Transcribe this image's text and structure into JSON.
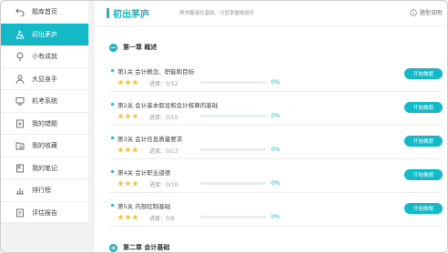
{
  "sidebar": {
    "items": [
      {
        "label": "题库首页",
        "icon": "back-arrow-icon",
        "active": false
      },
      {
        "label": "初出茅庐",
        "icon": "mountain-flag-icon",
        "active": true
      },
      {
        "label": "小有成就",
        "icon": "pin-icon",
        "active": false
      },
      {
        "label": "大显身手",
        "icon": "person-icon",
        "active": false
      },
      {
        "label": "机考系统",
        "icon": "monitor-icon",
        "active": false
      },
      {
        "label": "我的错题",
        "icon": "wrong-book-icon",
        "active": false
      },
      {
        "label": "我的收藏",
        "icon": "folder-star-icon",
        "active": false
      },
      {
        "label": "我的笔记",
        "icon": "notebook-icon",
        "active": false
      },
      {
        "label": "排行榜",
        "icon": "bar-chart-icon",
        "active": false
      },
      {
        "label": "评估报告",
        "icon": "report-icon",
        "active": false
      }
    ]
  },
  "header": {
    "title": "初出茅庐",
    "subtitle": "帮学霸强化基础、分层掌握细提升",
    "help_label": "题型说明"
  },
  "chapters": [
    {
      "toggle": "−",
      "label": "第一章 概述",
      "lessons": [
        {
          "name": "第1关 会计概念、职能和目标",
          "progress_text": "进度：0/12",
          "percent_text": "0%",
          "percent": 0,
          "button": "开始做题"
        },
        {
          "name": "第2关 会计基本假设和会计核算的基础",
          "progress_text": "进度：0/15",
          "percent_text": "0%",
          "percent": 0,
          "button": "开始做题"
        },
        {
          "name": "第3关 会计信息质量要求",
          "progress_text": "进度：0/13",
          "percent_text": "0%",
          "percent": 0,
          "button": "开始做题"
        },
        {
          "name": "第4关 会计职业道德",
          "progress_text": "进度：0/10",
          "percent_text": "0%",
          "percent": 0,
          "button": "开始做题"
        },
        {
          "name": "第5关 内部控制基础",
          "progress_text": "进度：0/8",
          "percent_text": "0%",
          "percent": 0,
          "button": "开始做题"
        }
      ]
    },
    {
      "toggle": "+",
      "label": "第二章 会计基础",
      "lessons": []
    }
  ],
  "colors": {
    "accent": "#14b9c8",
    "star": "#f5c242"
  }
}
